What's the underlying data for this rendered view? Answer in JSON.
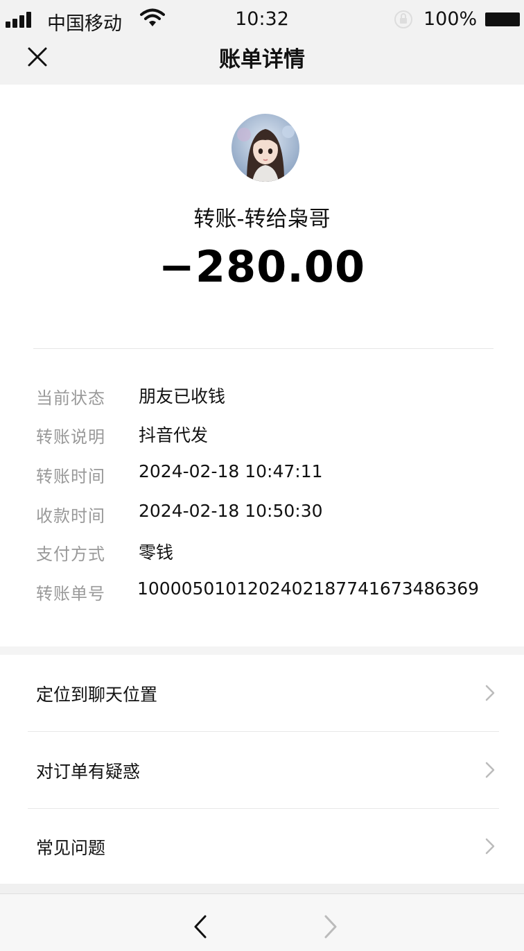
{
  "status_bar": {
    "carrier": "中国移动",
    "time": "10:32",
    "battery": "100%",
    "icons": [
      "signal-icon",
      "wifi-icon",
      "rotation-lock-icon",
      "battery-icon"
    ]
  },
  "nav": {
    "title": "账单详情",
    "close_icon": "close-icon"
  },
  "transfer": {
    "title": "转账-转给枭哥",
    "amount": "−280.00"
  },
  "details": [
    {
      "label": "当前状态",
      "value": "朋友已收钱"
    },
    {
      "label": "转账说明",
      "value": "抖音代发"
    },
    {
      "label": "转账时间",
      "value": "2024-02-18 10:47:11"
    },
    {
      "label": "收款时间",
      "value": "2024-02-18 10:50:30"
    },
    {
      "label": "支付方式",
      "value": "零钱"
    },
    {
      "label": "转账单号",
      "value": "100005010120240218774167348636​9"
    }
  ],
  "menu": [
    {
      "label": "定位到聊天位置",
      "icon": "chevron-right-icon"
    },
    {
      "label": "对订单有疑惑",
      "icon": "chevron-right-icon"
    },
    {
      "label": "常见问题",
      "icon": "chevron-right-icon"
    }
  ],
  "bottom_nav": {
    "back_icon": "chevron-left-icon",
    "forward_icon": "chevron-right-icon"
  },
  "colors": {
    "header_bg": "#f2f2f2",
    "label_gray": "#999999",
    "text": "#111111"
  }
}
